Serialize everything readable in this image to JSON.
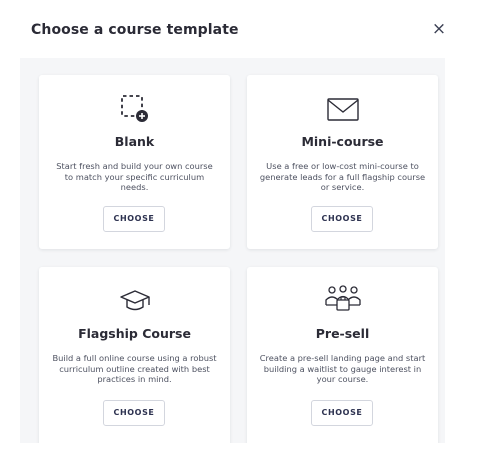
{
  "header": {
    "title": "Choose a course template",
    "close_label": "×"
  },
  "templates": [
    {
      "icon": "blank-template-icon",
      "title": "Blank",
      "description": "Start fresh and build your own course to match your specific curriculum needs.",
      "button": "CHOOSE"
    },
    {
      "icon": "envelope-icon",
      "title": "Mini-course",
      "description": "Use a free or low-cost mini-course to generate leads for a full flagship course or service.",
      "button": "CHOOSE"
    },
    {
      "icon": "graduation-cap-icon",
      "title": "Flagship Course",
      "description": "Build a full online course using a robust curriculum outline created with best practices in mind.",
      "button": "CHOOSE"
    },
    {
      "icon": "group-icon",
      "title": "Pre-sell",
      "description": "Create a pre-sell landing page and start building a waitlist to gauge interest in your course.",
      "button": "CHOOSE"
    }
  ]
}
